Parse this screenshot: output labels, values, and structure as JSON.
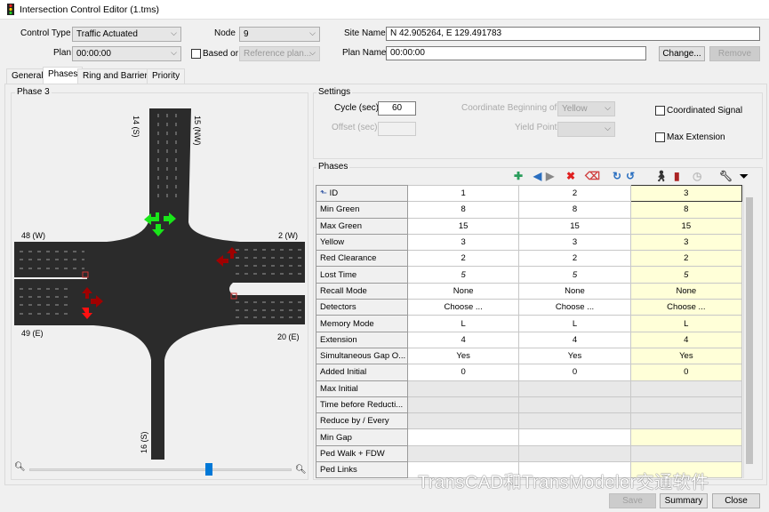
{
  "window": {
    "title": "Intersection Control Editor (1.tms)"
  },
  "form": {
    "control_type_label": "Control Type",
    "control_type": "Traffic Actuated",
    "plan_label": "Plan",
    "plan": "00:00:00",
    "node_label": "Node",
    "node": "9",
    "based_on_label": "Based or",
    "reference_plan": "Reference plan...",
    "site_name_label": "Site Name",
    "site_name": "N 42.905264, E 129.491783",
    "plan_name_label": "Plan Name",
    "plan_name": "00:00:00",
    "change_label": "Change...",
    "remove_label": "Remove"
  },
  "tabs": [
    {
      "label": "General"
    },
    {
      "label": "Phases"
    },
    {
      "label": "Ring and Barrier"
    },
    {
      "label": "Priority"
    }
  ],
  "diagram": {
    "title": "Phase 3",
    "approaches": {
      "north_left": "14 (S)",
      "north_right": "15 (NW)",
      "west_top": "48 (W)",
      "west_bottom": "49 (E)",
      "east_top": "2 (W)",
      "east_bottom": "20 (E)",
      "south": "16 (S)"
    },
    "zoom_level": 0.68,
    "colors": {
      "green": "#19e619",
      "dark_red": "#a00000",
      "red": "#ff1010",
      "road": "#2b2b2b"
    }
  },
  "settings": {
    "title": "Settings",
    "cycle_label": "Cycle (sec)",
    "cycle": "60",
    "offset_label": "Offset (sec)",
    "coord_label": "Coordinate Beginning of",
    "coord_value": "Yellow",
    "yield_label": "Yield Point",
    "coordinated_label": "Coordinated Signal",
    "max_ext_label": "Max Extension"
  },
  "phases": {
    "title": "Phases",
    "toolbar": [
      "add-icon",
      "move-left-icon",
      "move-right-icon",
      "delete-icon",
      "eraser-icon",
      "redo-icon",
      "undo-icon",
      "pedestrian-icon",
      "signal-icon",
      "clock-icon",
      "wrench-icon",
      "more-icon"
    ],
    "rows": [
      {
        "label": "ID",
        "values": [
          "1",
          "2",
          "3"
        ]
      },
      {
        "label": "Min Green",
        "values": [
          "8",
          "8",
          "8"
        ]
      },
      {
        "label": "Max Green",
        "values": [
          "15",
          "15",
          "15"
        ]
      },
      {
        "label": "Yellow",
        "values": [
          "3",
          "3",
          "3"
        ]
      },
      {
        "label": "Red Clearance",
        "values": [
          "2",
          "2",
          "2"
        ]
      },
      {
        "label": "Lost Time",
        "values": [
          "5",
          "5",
          "5"
        ]
      },
      {
        "label": "Recall Mode",
        "values": [
          "None",
          "None",
          "None"
        ]
      },
      {
        "label": "Detectors",
        "values": [
          "Choose ...",
          "Choose ...",
          "Choose ..."
        ]
      },
      {
        "label": "Memory Mode",
        "values": [
          "L",
          "L",
          "L"
        ]
      },
      {
        "label": "Extension",
        "values": [
          "4",
          "4",
          "4"
        ]
      },
      {
        "label": "Simultaneous Gap O...",
        "values": [
          "Yes",
          "Yes",
          "Yes"
        ]
      },
      {
        "label": "Added Initial",
        "values": [
          "0",
          "0",
          "0"
        ]
      },
      {
        "label": "Max Initial",
        "values": [
          "",
          "",
          ""
        ]
      },
      {
        "label": "Time before Reducti...",
        "values": [
          "",
          "",
          ""
        ]
      },
      {
        "label": "Reduce by / Every",
        "values": [
          "",
          "",
          ""
        ]
      },
      {
        "label": "Min Gap",
        "values": [
          "",
          "",
          ""
        ]
      },
      {
        "label": "Ped Walk + FDW",
        "values": [
          "",
          "",
          ""
        ]
      },
      {
        "label": "Ped Links",
        "values": [
          "",
          "",
          ""
        ]
      }
    ]
  },
  "footer": {
    "save": "Save",
    "summary": "Summary",
    "close": "Close"
  },
  "watermark": "TransCAD和TransModeler交通软件"
}
